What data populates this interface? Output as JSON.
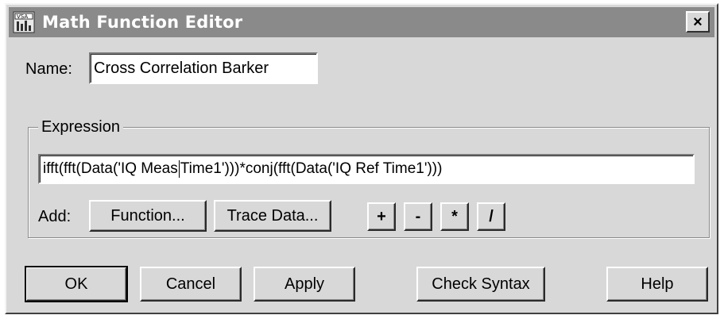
{
  "window": {
    "title": "Math Function Editor",
    "close_label": "×"
  },
  "name_field": {
    "label": "Name:",
    "value": "Cross Correlation Barker"
  },
  "expression": {
    "group_label": "Expression",
    "value_before_caret": "ifft(fft(Data('IQ Meas",
    "value_after_caret": " Time1')))*conj(fft(Data('IQ Ref Time1')))",
    "add_label": "Add:",
    "function_button": "Function...",
    "trace_data_button": "Trace Data...",
    "operators": [
      "+",
      "-",
      "*",
      "/"
    ]
  },
  "buttons": {
    "ok": "OK",
    "cancel": "Cancel",
    "apply": "Apply",
    "check_syntax": "Check Syntax",
    "help": "Help"
  }
}
